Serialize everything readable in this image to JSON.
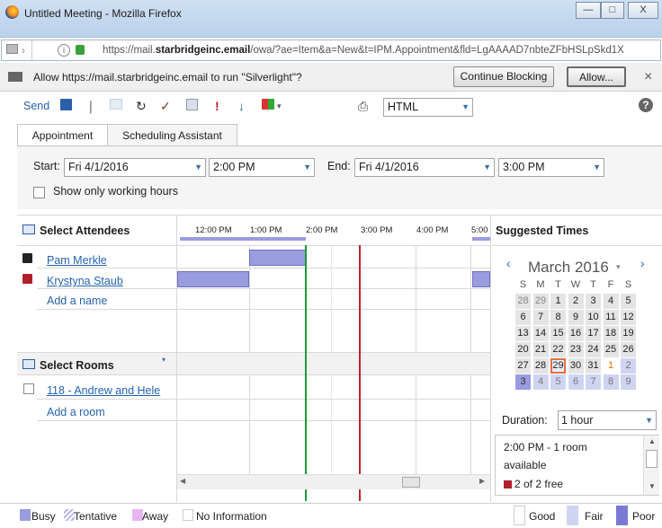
{
  "window": {
    "title": "Untitled Meeting - Mozilla Firefox",
    "minimize": "—",
    "maximize": "□",
    "close": "X"
  },
  "url": {
    "prefix": "https://mail.",
    "domain": "starbridgeinc.email",
    "rest": "/owa/?ae=Item&a=New&t=IPM.Appointment&fld=LgAAAAD7nbteZFbHSLpSkd1X"
  },
  "notification": {
    "text": "Allow https://mail.starbridgeinc.email to run \"Silverlight\"?",
    "continue_blocking": "Continue Blocking",
    "allow": "Allow...",
    "close": "×"
  },
  "toolbar": {
    "send": "Send",
    "format": "HTML",
    "help": "?"
  },
  "tabs": [
    {
      "label": "Appointment"
    },
    {
      "label": "Scheduling Assistant"
    }
  ],
  "form": {
    "start_label": "Start:",
    "start_date": "Fri 4/1/2016",
    "start_time": "2:00 PM",
    "end_label": "End:",
    "end_date": "Fri 4/1/2016",
    "end_time": "3:00 PM",
    "working_hours": "Show only working hours"
  },
  "attendees": {
    "header": "Select Attendees",
    "people": [
      {
        "name": "Pam Merkle"
      },
      {
        "name": "Krystyna Staub"
      }
    ],
    "add": "Add a name"
  },
  "rooms": {
    "header": "Select Rooms",
    "items": [
      {
        "name": "118 - Andrew and Hele"
      }
    ],
    "add": "Add a room"
  },
  "timeline": {
    "hours": [
      "12:00 PM",
      "1:00 PM",
      "2:00 PM",
      "3:00 PM",
      "4:00 PM",
      "5:00"
    ]
  },
  "suggested": {
    "header": "Suggested Times",
    "month": "March 2016",
    "weekdays": [
      "S",
      "M",
      "T",
      "W",
      "T",
      "F",
      "S"
    ],
    "weeks": [
      [
        "28",
        "29",
        "1",
        "2",
        "3",
        "4",
        "5"
      ],
      [
        "6",
        "7",
        "8",
        "9",
        "10",
        "11",
        "12"
      ],
      [
        "13",
        "14",
        "15",
        "16",
        "17",
        "18",
        "19"
      ],
      [
        "20",
        "21",
        "22",
        "23",
        "24",
        "25",
        "26"
      ],
      [
        "27",
        "28",
        "29",
        "30",
        "31",
        "1",
        "2"
      ],
      [
        "3",
        "4",
        "5",
        "6",
        "7",
        "8",
        "9"
      ]
    ],
    "duration_label": "Duration:",
    "duration": "1 hour",
    "slot_time": "2:00 PM - 1 room",
    "slot_available": "available",
    "slot_free": "2 of 2 free"
  },
  "legend": {
    "busy": "Busy",
    "tentative": "Tentative",
    "away": "Away",
    "no_info": "No Information",
    "good": "Good",
    "fair": "Fair",
    "poor": "Poor"
  },
  "colors": {
    "busy": "#9a9ce0",
    "start_line": "#1a9a3a",
    "end_line": "#c0232a",
    "accent": "#2563b0"
  }
}
